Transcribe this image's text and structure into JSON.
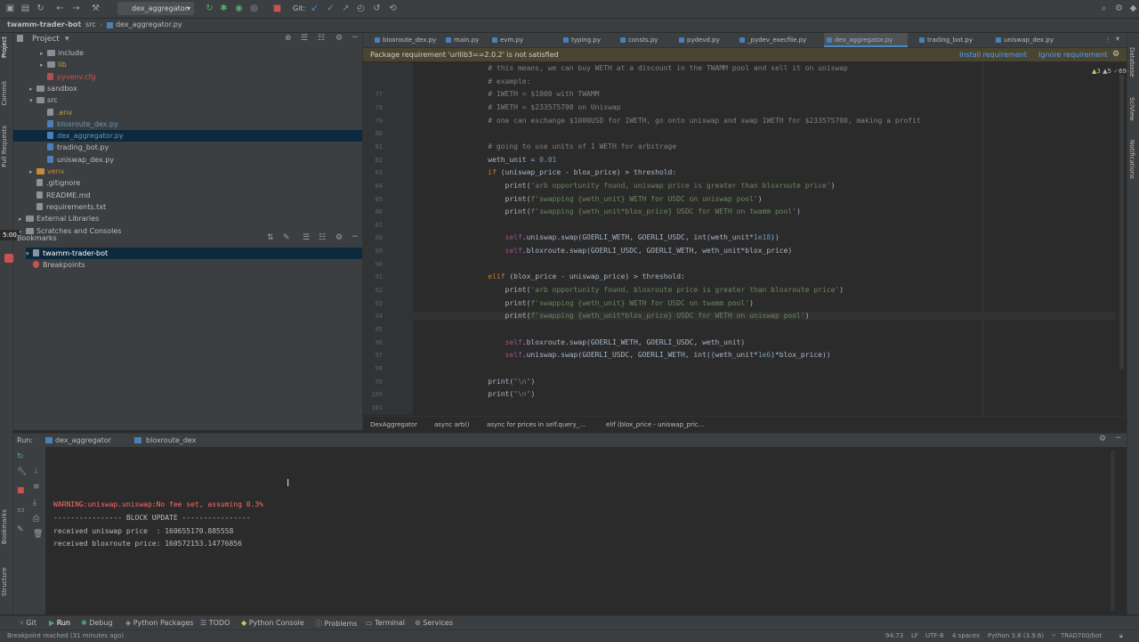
{
  "nav": {
    "project": "twamm-trader-bot",
    "folder": "src",
    "file": "dex_aggregator.py"
  },
  "toolbar": {
    "run_config": "dex_aggregator",
    "git_label": "Git:"
  },
  "project_panel": {
    "title": "Project",
    "tree": [
      {
        "label": "include",
        "type": "folder",
        "indent": 2,
        "arrow": "▸"
      },
      {
        "label": "lib",
        "type": "folder",
        "indent": 2,
        "arrow": "▸",
        "color": "#b8a14a"
      },
      {
        "label": "pyvenv.cfg",
        "type": "cfg",
        "indent": 2,
        "arrow": "",
        "color": "#c75450"
      },
      {
        "label": "sandbox",
        "type": "folder",
        "indent": 1,
        "arrow": "▸"
      },
      {
        "label": "src",
        "type": "folder",
        "indent": 1,
        "arrow": "▾"
      },
      {
        "label": ".env",
        "type": "txt",
        "indent": 2,
        "arrow": "",
        "color": "#b8a14a"
      },
      {
        "label": "bloxroute_dex.py",
        "type": "py",
        "indent": 2,
        "arrow": "",
        "color": "#6897bb"
      },
      {
        "label": "dex_aggregator.py",
        "type": "py",
        "indent": 2,
        "arrow": "",
        "color": "#6897bb",
        "selected": true
      },
      {
        "label": "trading_bot.py",
        "type": "py",
        "indent": 2,
        "arrow": ""
      },
      {
        "label": "uniswap_dex.py",
        "type": "py",
        "indent": 2,
        "arrow": ""
      },
      {
        "label": "venv",
        "type": "folder-orange",
        "indent": 1,
        "arrow": "▸",
        "color": "#c98a3a"
      },
      {
        "label": ".gitignore",
        "type": "txt",
        "indent": 1,
        "arrow": ""
      },
      {
        "label": "README.md",
        "type": "txt",
        "indent": 1,
        "arrow": ""
      },
      {
        "label": "requirements.txt",
        "type": "txt",
        "indent": 1,
        "arrow": ""
      },
      {
        "label": "External Libraries",
        "type": "folder",
        "indent": 0,
        "arrow": "▸"
      },
      {
        "label": "Scratches and Consoles",
        "type": "folder",
        "indent": 0,
        "arrow": "▸"
      }
    ],
    "bookmarks_title": "Bookmarks",
    "bookmarks": [
      {
        "label": "twamm-trader-bot",
        "selected": true
      },
      {
        "label": "Breakpoints",
        "selected": false
      }
    ],
    "timer": "5:00"
  },
  "tabs": [
    {
      "label": "bloxroute_dex.py",
      "active": false
    },
    {
      "label": "main.py",
      "active": false
    },
    {
      "label": "evm.py",
      "active": false
    },
    {
      "label": "typing.py",
      "active": false
    },
    {
      "label": "consts.py",
      "active": false
    },
    {
      "label": "pydevd.py",
      "active": false
    },
    {
      "label": "_pydev_execfile.py",
      "active": false
    },
    {
      "label": "dex_aggregator.py",
      "active": true
    },
    {
      "label": "trading_bot.py",
      "active": false
    },
    {
      "label": "uniswap_dex.py",
      "active": false
    }
  ],
  "notification": {
    "message": "Package requirement 'urllib3==2.0.2' is not satisfied",
    "install": "Install requirement",
    "ignore": "Ignore requirement"
  },
  "inspections": {
    "warnings": "3",
    "weak": "5",
    "typos": "69"
  },
  "editor": {
    "current_line": 94,
    "lines": [
      {
        "n": "",
        "tokens": [
          [
            "cmt",
            "    # this means, we can buy WETH at a discount in the TWAMM pool and sell it on uniswap"
          ]
        ]
      },
      {
        "n": "",
        "tokens": [
          [
            "cmt",
            "    # example:"
          ]
        ]
      },
      {
        "n": "77",
        "tokens": [
          [
            "cmt",
            "    # 1WETH = $1000 with TWAMM"
          ]
        ]
      },
      {
        "n": "78",
        "tokens": [
          [
            "cmt",
            "    # 1WETH = $233575700 on Uniswap"
          ]
        ]
      },
      {
        "n": "79",
        "tokens": [
          [
            "cmt",
            "    # one can exchange $1000USD for 1WETH, go onto uniswap and swap 1WETH for $233575700, making a profit"
          ]
        ]
      },
      {
        "n": "80",
        "tokens": []
      },
      {
        "n": "81",
        "tokens": [
          [
            "cmt",
            "    # going to use units of 1 WETH for arbitrage"
          ]
        ]
      },
      {
        "n": "82",
        "tokens": [
          [
            "fn",
            "    weth_unit = "
          ],
          [
            "num",
            "0.01"
          ]
        ]
      },
      {
        "n": "83",
        "tokens": [
          [
            "kw",
            "    if "
          ],
          [
            "fn",
            "(uniswap_price - blox_price) > threshold:"
          ]
        ]
      },
      {
        "n": "84",
        "tokens": [
          [
            "fn",
            "        print("
          ],
          [
            "str",
            "'arb opportunity found, uniswap price is greater than bloxroute price'"
          ],
          [
            "fn",
            ")"
          ]
        ]
      },
      {
        "n": "85",
        "tokens": [
          [
            "fn",
            "        print("
          ],
          [
            "str",
            "f'swapping {weth_unit} WETH for USDC on uniswap pool'"
          ],
          [
            "fn",
            ")"
          ]
        ]
      },
      {
        "n": "86",
        "tokens": [
          [
            "fn",
            "        print("
          ],
          [
            "str",
            "f'swapping {weth_unit*blox_price} USDC for WETH on twamm pool'"
          ],
          [
            "fn",
            ")"
          ]
        ]
      },
      {
        "n": "87",
        "tokens": []
      },
      {
        "n": "88",
        "tokens": [
          [
            "slf",
            "        self"
          ],
          [
            "fn",
            ".uniswap.swap(GOERLI_WETH, GOERLI_USDC, int(weth_unit*"
          ],
          [
            "num",
            "1e18"
          ],
          [
            "fn",
            "))"
          ]
        ]
      },
      {
        "n": "89",
        "tokens": [
          [
            "slf",
            "        self"
          ],
          [
            "fn",
            ".bloxroute.swap(GOERLI_USDC, GOERLI_WETH, weth_unit*blox_price)"
          ]
        ]
      },
      {
        "n": "90",
        "tokens": []
      },
      {
        "n": "91",
        "tokens": [
          [
            "kw",
            "    elif "
          ],
          [
            "fn",
            "(blox_price - uniswap_price) > threshold:"
          ]
        ]
      },
      {
        "n": "92",
        "tokens": [
          [
            "fn",
            "        print("
          ],
          [
            "str",
            "'arb opportunity found, bloxroute price is greater than bloxroute price'"
          ],
          [
            "fn",
            ")"
          ]
        ]
      },
      {
        "n": "93",
        "tokens": [
          [
            "fn",
            "        print("
          ],
          [
            "str",
            "f'swapping {weth_unit} WETH for USDC on twamm pool'"
          ],
          [
            "fn",
            ")"
          ]
        ]
      },
      {
        "n": "94",
        "tokens": [
          [
            "fn",
            "        print("
          ],
          [
            "str",
            "f'swapping {weth_unit*blox_price} USDC for WETH on uniswap pool'"
          ],
          [
            "fn",
            ")"
          ]
        ]
      },
      {
        "n": "95",
        "tokens": []
      },
      {
        "n": "96",
        "tokens": [
          [
            "slf",
            "        self"
          ],
          [
            "fn",
            ".bloxroute.swap(GOERLI_WETH, GOERLI_USDC, weth_unit)"
          ]
        ]
      },
      {
        "n": "97",
        "tokens": [
          [
            "slf",
            "        self"
          ],
          [
            "fn",
            ".uniswap.swap(GOERLI_USDC, GOERLI_WETH, int((weth_unit*"
          ],
          [
            "num",
            "1e6"
          ],
          [
            "fn",
            ")*blox_price))"
          ]
        ]
      },
      {
        "n": "98",
        "tokens": []
      },
      {
        "n": "99",
        "tokens": [
          [
            "fn",
            "    print("
          ],
          [
            "str",
            "\"\\n\""
          ],
          [
            "fn",
            ")"
          ]
        ]
      },
      {
        "n": "100",
        "tokens": [
          [
            "fn",
            "    print("
          ],
          [
            "str",
            "\"\\n\""
          ],
          [
            "fn",
            ")"
          ]
        ]
      },
      {
        "n": "101",
        "tokens": []
      }
    ]
  },
  "breadcrumbs": [
    "DexAggregator",
    "async arb()",
    "async for prices in self.query_...",
    "elif (blox_price - uniswap_pric..."
  ],
  "run": {
    "label": "Run:",
    "tabs": [
      {
        "label": "dex_aggregator",
        "active": true
      },
      {
        "label": "bloxroute_dex",
        "active": false
      }
    ],
    "console": [
      {
        "text": "WARNING:uniswap.uniswap:No fee set, assuming 0.3%",
        "color": "#ff6b68"
      },
      {
        "text": "---------------- BLOCK UPDATE ----------------",
        "color": "#bbbbbb"
      },
      {
        "text": "received uniswap price  : 160655170.885558",
        "color": "#bbbbbb"
      },
      {
        "text": "received bloxroute price: 160572153.14776856",
        "color": "#bbbbbb"
      }
    ]
  },
  "bottom_tabs": [
    "Git",
    "Run",
    "Debug",
    "Python Packages",
    "TODO",
    "Python Console",
    "Problems",
    "Terminal",
    "Services"
  ],
  "status": {
    "message": "Breakpoint reached (31 minutes ago)",
    "position": "94:73",
    "line_sep": "LF",
    "encoding": "UTF-8",
    "indent": "4 spaces",
    "interpreter": "Python 3.8 (3.9.6)",
    "branch": "TRAD700/bot"
  },
  "side_labels": {
    "left": [
      "Project",
      "Commit",
      "Pull Requests",
      "Bookmarks",
      "Structure"
    ],
    "right": [
      "Database",
      "SciView",
      "Notifications"
    ]
  }
}
